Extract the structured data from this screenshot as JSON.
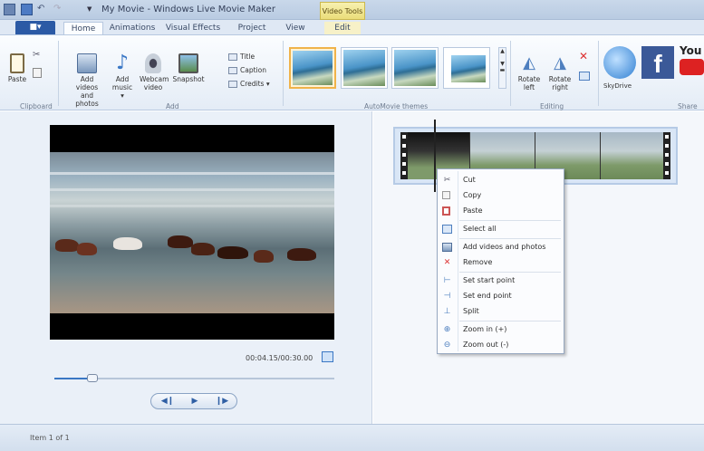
{
  "window": {
    "title": "My Movie - Windows Live Movie Maker",
    "context_tab_group": "Video Tools"
  },
  "ribbon": {
    "file_button": "■▾",
    "tabs": [
      {
        "label": "Home",
        "active": true
      },
      {
        "label": "Animations"
      },
      {
        "label": "Visual Effects"
      },
      {
        "label": "Project"
      },
      {
        "label": "View"
      },
      {
        "label": "Edit"
      }
    ],
    "clipboard": {
      "paste": "Paste",
      "group": "Clipboard"
    },
    "add": {
      "add_videos_line1": "Add videos",
      "add_videos_line2": "and photos",
      "add_music_line1": "Add",
      "add_music_line2": "music ▾",
      "webcam_line1": "Webcam",
      "webcam_line2": "video",
      "snapshot": "Snapshot",
      "title": "Title",
      "caption": "Caption",
      "credits": "Credits ▾",
      "group": "Add"
    },
    "themes": {
      "group": "AutoMovie themes"
    },
    "editing": {
      "rotate_left_line1": "Rotate",
      "rotate_left_line2": "left",
      "rotate_right_line1": "Rotate",
      "rotate_right_line2": "right",
      "group": "Editing"
    },
    "share": {
      "skydrive": "SkyDrive",
      "facebook": "f",
      "youtube": "You",
      "group": "Share"
    }
  },
  "preview": {
    "time": "00:04.15/00:30.00"
  },
  "context_menu": {
    "items": [
      {
        "label": "Cut",
        "icon": "scissors-icon"
      },
      {
        "label": "Copy",
        "icon": "copy-icon"
      },
      {
        "label": "Paste",
        "icon": "paste-icon"
      },
      {
        "label": "Select all",
        "icon": "select-all-icon"
      },
      {
        "label": "Add videos and photos",
        "icon": "add-media-icon"
      },
      {
        "label": "Remove",
        "icon": "remove-icon"
      },
      {
        "label": "Set start point",
        "icon": "start-point-icon"
      },
      {
        "label": "Set end point",
        "icon": "end-point-icon"
      },
      {
        "label": "Split",
        "icon": "split-icon"
      },
      {
        "label": "Zoom in (+)",
        "icon": "zoom-in-icon"
      },
      {
        "label": "Zoom out (-)",
        "icon": "zoom-out-icon"
      }
    ]
  },
  "status": {
    "item_count": "Item 1 of 1"
  },
  "colors": {
    "accent": "#2c5aa5",
    "selection": "#f0b34a",
    "remove": "#d33"
  }
}
